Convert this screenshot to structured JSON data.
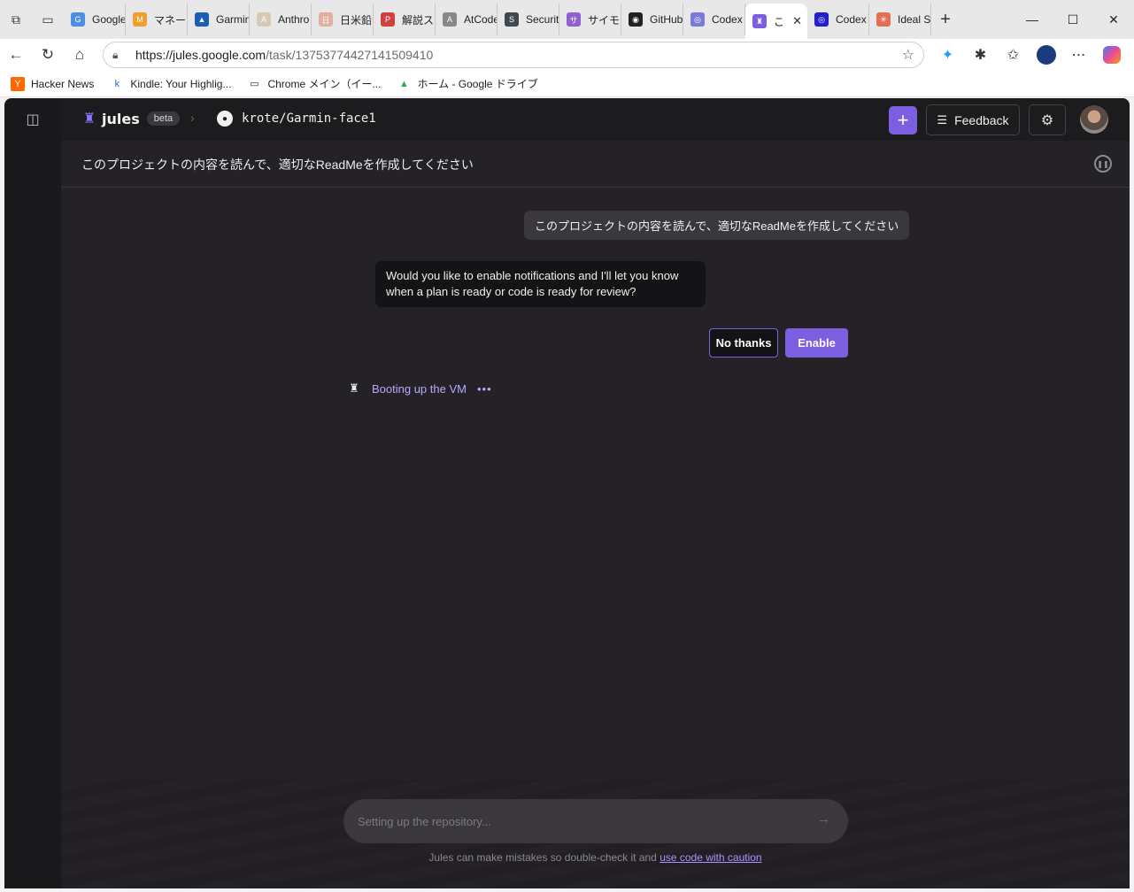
{
  "browser": {
    "tabs": [
      {
        "label": "Google",
        "color": "#4a8fe0",
        "glyph": "G"
      },
      {
        "label": "マネーフ",
        "color": "#f0a030",
        "glyph": "M"
      },
      {
        "label": "Garmin",
        "color": "#1a5fb4",
        "glyph": "▲"
      },
      {
        "label": "Anthro",
        "color": "#d8c8b8",
        "glyph": "A"
      },
      {
        "label": "日米鉛",
        "color": "#e0b0a0",
        "glyph": "日"
      },
      {
        "label": "解説ス",
        "color": "#d04040",
        "glyph": "P"
      },
      {
        "label": "AtCode",
        "color": "#888888",
        "glyph": "A"
      },
      {
        "label": "Securit",
        "color": "#404850",
        "glyph": "S"
      },
      {
        "label": "サイモン",
        "color": "#9060d0",
        "glyph": "サ"
      },
      {
        "label": "GitHub",
        "color": "#222222",
        "glyph": "◉"
      },
      {
        "label": "Codex",
        "color": "#7a7ad8",
        "glyph": "◎"
      }
    ],
    "active_tab": {
      "label": "こ",
      "color": "#7b5fe0",
      "glyph": "♜"
    },
    "after_tabs": [
      {
        "label": "Codex",
        "color": "#2020d0",
        "glyph": "◎"
      },
      {
        "label": "Ideal S",
        "color": "#e07050",
        "glyph": "✳"
      }
    ],
    "url_host": "https://jules.google.com",
    "url_path": "/task/13753774427141509410",
    "bookmarks": [
      {
        "label": "Hacker News",
        "icon": "Y",
        "bg": "#ff6600",
        "fg": "#ffffff"
      },
      {
        "label": "Kindle: Your Highlig...",
        "icon": "k",
        "bg": "transparent",
        "fg": "#1a6ed8"
      },
      {
        "label": "Chrome メイン（イー...",
        "icon": "▭",
        "bg": "transparent",
        "fg": "#333333"
      },
      {
        "label": "ホーム - Google ドライブ",
        "icon": "▲",
        "bg": "transparent",
        "fg": "#2da94f"
      }
    ]
  },
  "app": {
    "brand": "jules",
    "beta": "beta",
    "repo": "krote/Garmin-face1",
    "feedback_label": "Feedback",
    "task_title": "このプロジェクトの内容を読んで、適切なReadMeを作成してください",
    "user_message": "このプロジェクトの内容を読んで、適切なReadMeを作成してください",
    "notify_message": "Would you like to enable notifications and I'll let you know when a plan is ready or code is ready for review?",
    "no_thanks_label": "No thanks",
    "enable_label": "Enable",
    "status_text": "Booting up the VM",
    "input_placeholder": "Setting up the repository...",
    "disclaimer_prefix": "Jules can make mistakes so double-check it and ",
    "disclaimer_link": "use code with caution",
    "accent_color": "#7b5fe0"
  }
}
